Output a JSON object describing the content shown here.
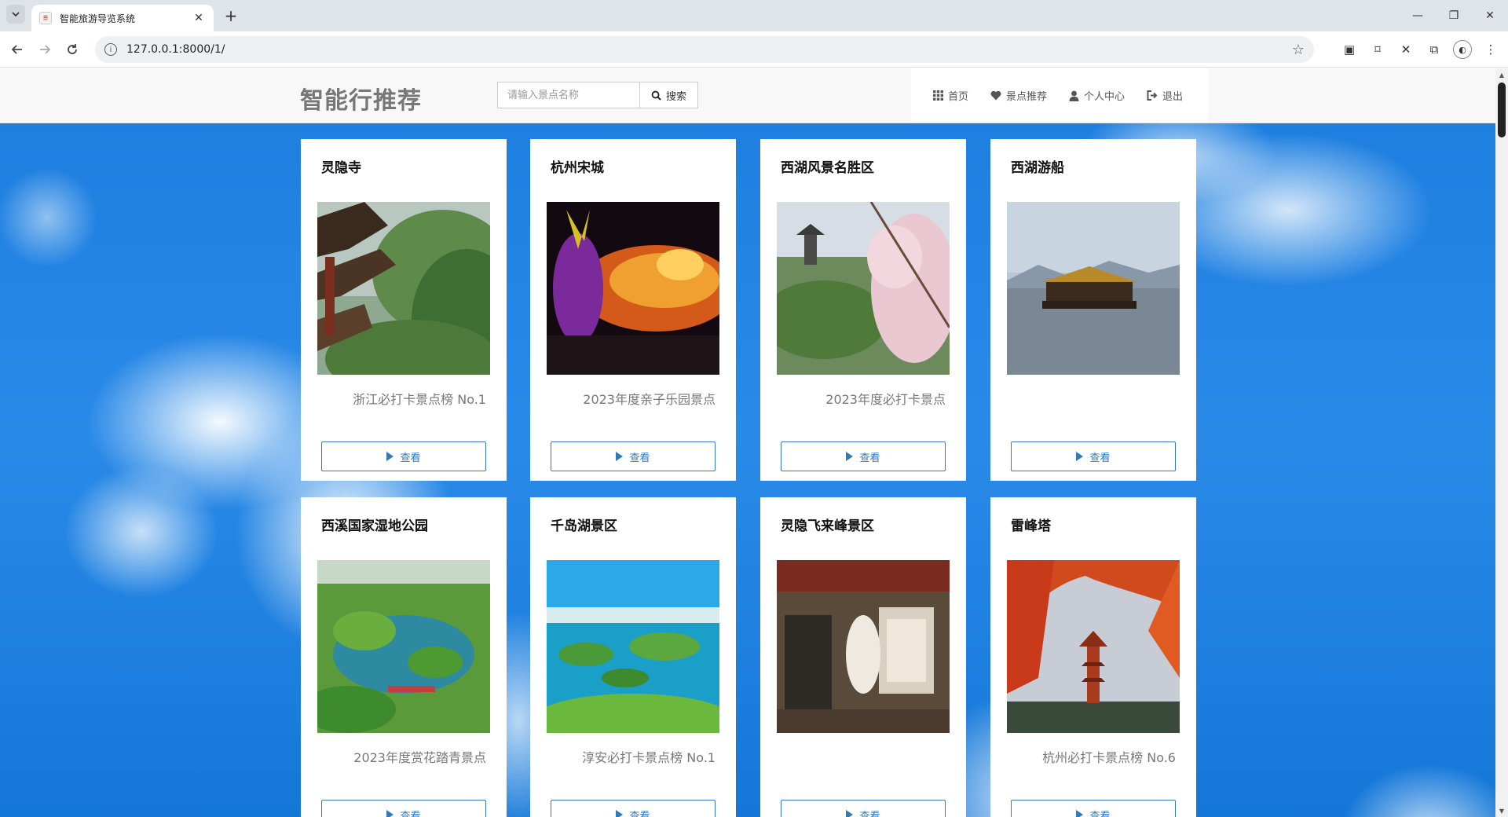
{
  "browser": {
    "tab_title": "智能旅游导览系统",
    "tab_favicon_text": "景",
    "tab_close": "✕",
    "new_tab": "+",
    "url": "127.0.0.1:8000/1/",
    "window_minimize": "—",
    "window_restore": "❐",
    "window_close": "✕"
  },
  "header": {
    "brand": "智能行推荐",
    "search": {
      "placeholder": "请输入景点名称",
      "button_label": "搜索"
    },
    "nav": [
      {
        "label": "首页",
        "icon": "grid-icon"
      },
      {
        "label": "景点推荐",
        "icon": "heart-icon"
      },
      {
        "label": "个人中心",
        "icon": "user-icon"
      },
      {
        "label": "退出",
        "icon": "logout-icon"
      }
    ]
  },
  "cards": [
    {
      "title": "灵隐寺",
      "tag": "浙江必打卡景点榜 No.1",
      "button": "查看",
      "image": "temple-roof-forest"
    },
    {
      "title": "杭州宋城",
      "tag": "2023年度亲子乐园景点",
      "button": "查看",
      "image": "dragon-performance"
    },
    {
      "title": "西湖风景名胜区",
      "tag": "2023年度必打卡景点",
      "button": "查看",
      "image": "lake-pavilion-blossom"
    },
    {
      "title": "西湖游船",
      "tag": "",
      "button": "查看",
      "image": "lake-boat"
    },
    {
      "title": "西溪国家湿地公园",
      "tag": "2023年度赏花踏青景点",
      "button": "查看",
      "image": "wetland-aerial"
    },
    {
      "title": "千岛湖景区",
      "tag": "淳安必打卡景点榜 No.1",
      "button": "查看",
      "image": "islands-lake"
    },
    {
      "title": "灵隐飞来峰景区",
      "tag": "",
      "button": "查看",
      "image": "temple-buddha-sign"
    },
    {
      "title": "雷峰塔",
      "tag": "杭州必打卡景点榜 No.6",
      "button": "查看",
      "image": "pagoda-maple"
    }
  ],
  "colors": {
    "accent": "#337ab7",
    "sky": "#1f7fe0",
    "brand_text": "#777777"
  }
}
